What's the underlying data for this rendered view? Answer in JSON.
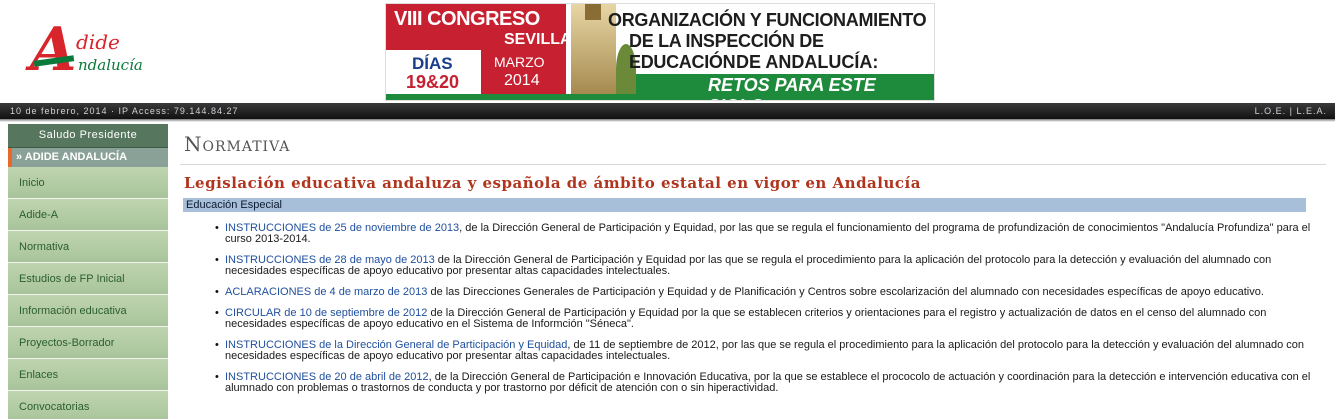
{
  "logo": {
    "letter": "A",
    "word_top": "dide",
    "word_bottom": "ndalucía"
  },
  "banner": {
    "congreso": "VIII CONGRESO",
    "ciudad": "SEVILLA",
    "dias": "DÍAS",
    "fechas": "19&20",
    "mes": "MARZO",
    "anio": "2014",
    "titulo_1": "ORGANIZACIÓN Y FUNCIONAMIENTO",
    "titulo_2": "DE LA INSPECCIÓN DE EDUCACIÓN",
    "titulo_3": "DE ANDALUCÍA:",
    "lema": "RETOS PARA ESTE SIGLO."
  },
  "infobar": {
    "date_ip": "10 de febrero, 2014 · IP Access: 79.144.84.27",
    "links": "L.O.E. | L.E.A."
  },
  "sidebar": {
    "header": "Saludo Presidente",
    "active": "» ADIDE ANDALUCÍA",
    "items": [
      {
        "label": "Inicio"
      },
      {
        "label": "Adide-A"
      },
      {
        "label": "Normativa"
      },
      {
        "label": "Estudios de FP Inicial"
      },
      {
        "label": "Información educativa"
      },
      {
        "label": "Proyectos-Borrador"
      },
      {
        "label": "Enlaces"
      },
      {
        "label": "Convocatorias"
      }
    ]
  },
  "main": {
    "title": "Normativa",
    "heading": "Legislación educativa andaluza y española de ámbito estatal en vigor en Andalucía",
    "category": "Educación Especial",
    "items": [
      {
        "link": "INSTRUCCIONES de 25 de noviembre de 2013",
        "text": ", de la Dirección General de Participación y Equidad, por las que se regula el funcionamiento del programa de profundización de conocimientos \"Andalucía Profundiza\" para el curso 2013-2014."
      },
      {
        "link": "INSTRUCCIONES de 28 de mayo de 2013",
        "text": " de la Dirección General de Participación y Equidad por las que se regula el procedimiento para la aplicación del protocolo para la detección y evaluación del alumnado con necesidades específicas de apoyo educativo por presentar altas capacidades intelectuales."
      },
      {
        "link": "ACLARACIONES de 4 de marzo de 2013",
        "text": " de las Direcciones Generales de Participación y Equidad y de Planificación y Centros sobre escolarización del alumnado con necesidades específicas de apoyo educativo."
      },
      {
        "link": "CIRCULAR de 10 de septiembre de 2012",
        "text": " de la Dirección General de Participación y Equidad por la que se establecen criterios y orientaciones para el registro y actualización de datos en el censo del alumnado con necesidades específicas de apoyo educativo en el Sistema de Informción \"Séneca\"."
      },
      {
        "link": "INSTRUCCIONES de la Dirección General de Participación y Equidad",
        "text": ", de 11 de septiembre de 2012, por las que se regula el procedimiento para la aplicación del protocolo para la detección y evaluación del alumnado con necesidades específicas de apoyo educativo por presentar altas capacidades intelectuales."
      },
      {
        "link": "INSTRUCCIONES de 20 de abril de 2012",
        "text": ", de la Dirección General de Participación e Innovación Educativa, por la que se establece el prococolo de actuación y coordinación para la detección e intervención educativa con el alumnado con problemas o trastornos de conducta y por trastorno por déficit de atención con o sin hiperactividad."
      }
    ]
  }
}
